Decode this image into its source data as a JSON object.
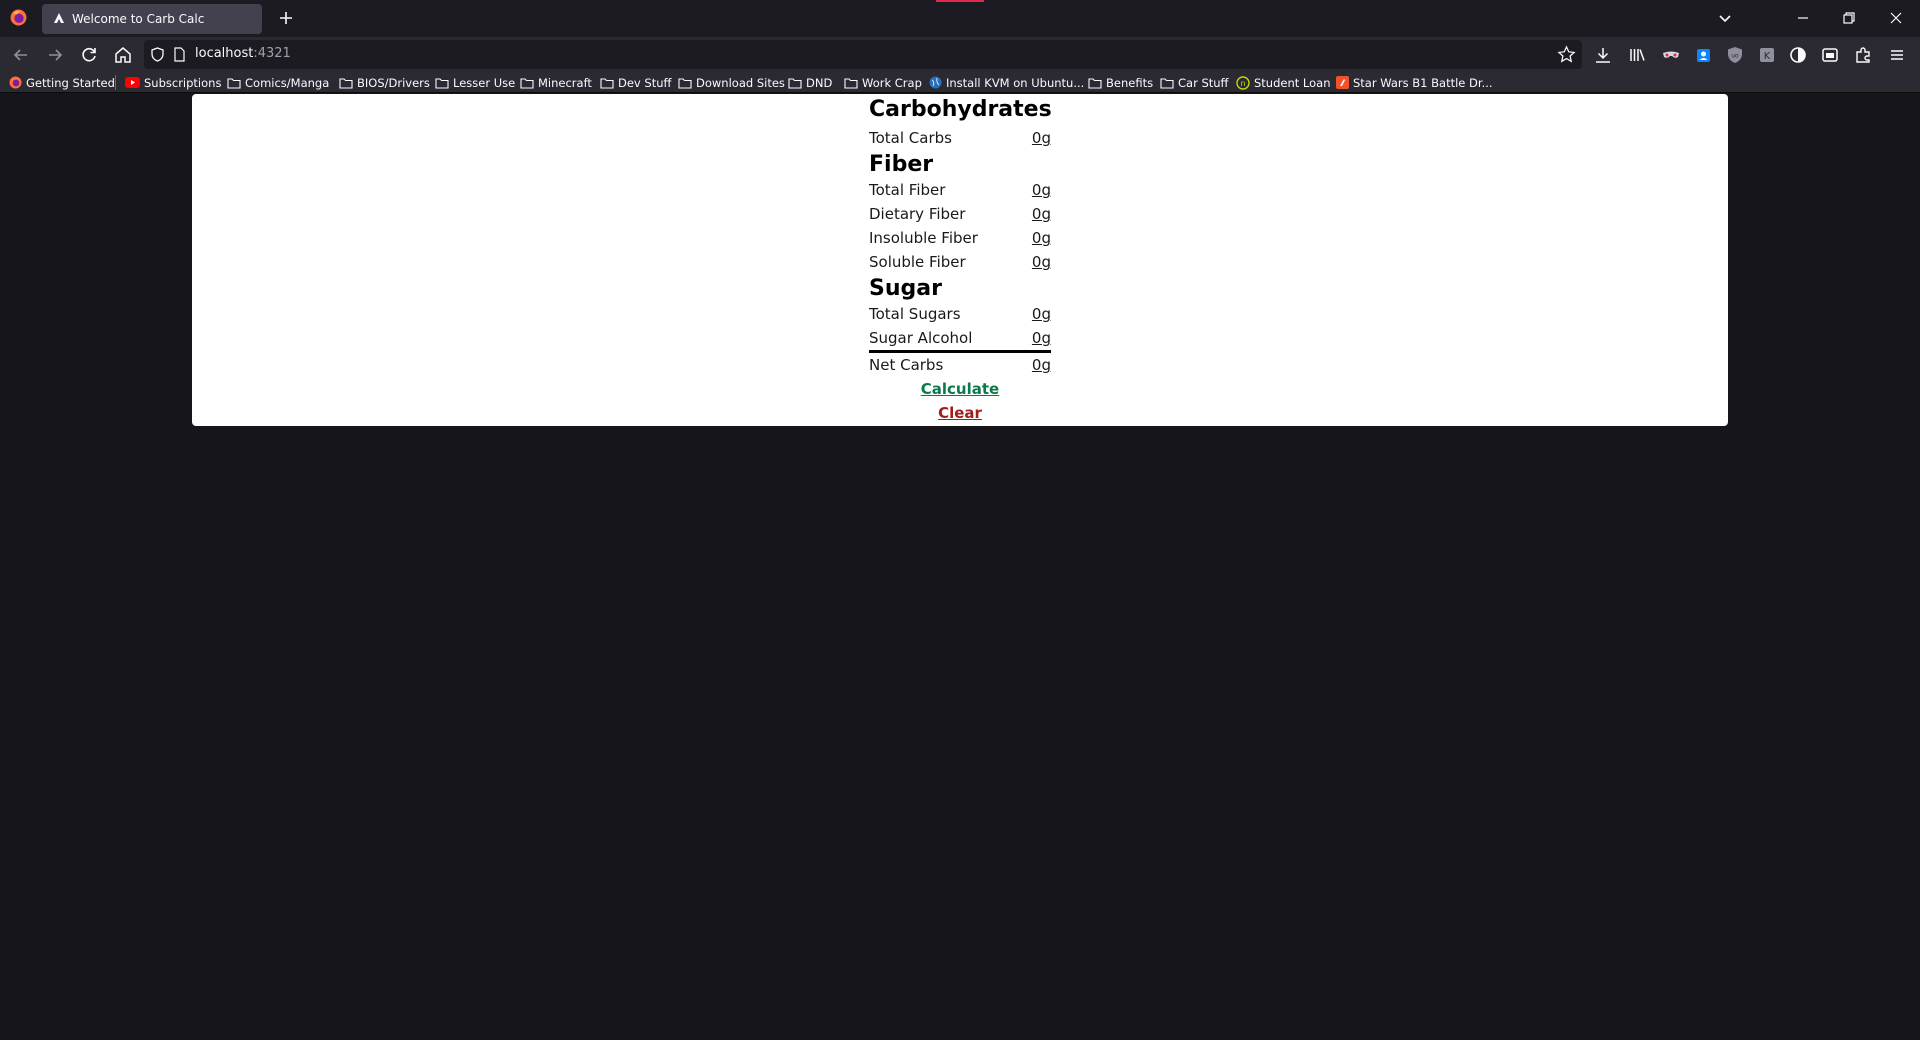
{
  "browser": {
    "tab": {
      "title": "Welcome to Carb Calc"
    },
    "url": {
      "host": "localhost",
      "port": ":4321"
    },
    "extension_badge": "0"
  },
  "bookmarks": [
    {
      "label": "Getting Started",
      "icon": "firefox-icon"
    },
    {
      "label": "Subscriptions",
      "icon": "youtube-icon"
    },
    {
      "label": "Comics/Manga",
      "icon": "folder-icon"
    },
    {
      "label": "BIOS/Drivers",
      "icon": "folder-icon"
    },
    {
      "label": "Lesser Use",
      "icon": "folder-icon"
    },
    {
      "label": "Minecraft",
      "icon": "folder-icon"
    },
    {
      "label": "Dev Stuff",
      "icon": "folder-icon"
    },
    {
      "label": "Download Sites",
      "icon": "folder-icon"
    },
    {
      "label": "DND",
      "icon": "folder-icon"
    },
    {
      "label": "Work Crap",
      "icon": "folder-icon"
    },
    {
      "label": "Install KVM on Ubuntu...",
      "icon": "globe-icon"
    },
    {
      "label": "Benefits",
      "icon": "folder-icon"
    },
    {
      "label": "Car Stuff",
      "icon": "folder-icon"
    },
    {
      "label": "Student Loan",
      "icon": "nelnet-icon"
    },
    {
      "label": "Star Wars B1 Battle Dr...",
      "icon": "bookmark-page-icon"
    }
  ],
  "calculator": {
    "carbs_heading": "Carbohydrates",
    "total_carbs": {
      "label": "Total Carbs",
      "value": "0g"
    },
    "fiber_heading": "Fiber",
    "total_fiber": {
      "label": "Total Fiber",
      "value": "0g"
    },
    "dietary_fiber": {
      "label": "Dietary Fiber",
      "value": "0g"
    },
    "insoluble_fiber": {
      "label": "Insoluble Fiber",
      "value": "0g"
    },
    "soluble_fiber": {
      "label": "Soluble Fiber",
      "value": "0g"
    },
    "sugar_heading": "Sugar",
    "total_sugars": {
      "label": "Total Sugars",
      "value": "0g"
    },
    "sugar_alcohol": {
      "label": "Sugar Alcohol",
      "value": "0g"
    },
    "net_carbs": {
      "label": "Net Carbs",
      "value": "0g"
    },
    "calculate_label": "Calculate",
    "clear_label": "Clear"
  },
  "colors": {
    "calculate": "#0b7a4b",
    "clear": "#a51c1c",
    "page_bg": "#15151b",
    "card_bg": "#ffffff"
  }
}
